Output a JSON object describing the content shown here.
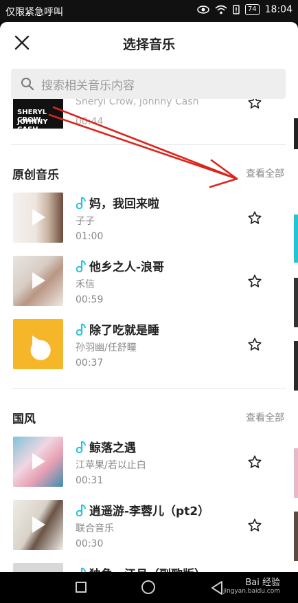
{
  "status_bar": {
    "carrier": "仅限紧急呼叫",
    "battery": "74",
    "time": "18:04"
  },
  "header": {
    "title": "选择音乐"
  },
  "search": {
    "placeholder": "搜索相关音乐内容"
  },
  "partial_track": {
    "cover_line1": "SHERYL CROW",
    "cover_line2": "JOHNNY CASH",
    "artist": "Sheryl Crow, Johnny Cash",
    "duration": "00:44"
  },
  "sections": [
    {
      "title": "原创音乐",
      "view_all": "查看全部",
      "tracks": [
        {
          "name": "妈，我回来啦",
          "artist": "子子",
          "duration": "01:00"
        },
        {
          "name": "他乡之人-浪哥",
          "artist": "禾信",
          "duration": "00:59"
        },
        {
          "name": "除了吃就是睡",
          "artist": "孙羽幽/任舒瞳",
          "duration": "00:37"
        }
      ]
    },
    {
      "title": "国风",
      "view_all": "查看全部",
      "tracks": [
        {
          "name": "鲸落之遇",
          "artist": "江苹果/若以止白",
          "duration": "00:31"
        },
        {
          "name": "逍遥游-李蓉儿（pt2）",
          "artist": "联合音乐",
          "duration": "00:30"
        },
        {
          "name": "独角…江月（副歌版）",
          "artist": "",
          "duration": ""
        }
      ]
    }
  ],
  "watermark": {
    "brand": "Bai 经验",
    "url": "jingyan.baidu.com"
  },
  "colors": {
    "accent": "#24c3d6",
    "annotation_arrow": "#d9261c"
  }
}
